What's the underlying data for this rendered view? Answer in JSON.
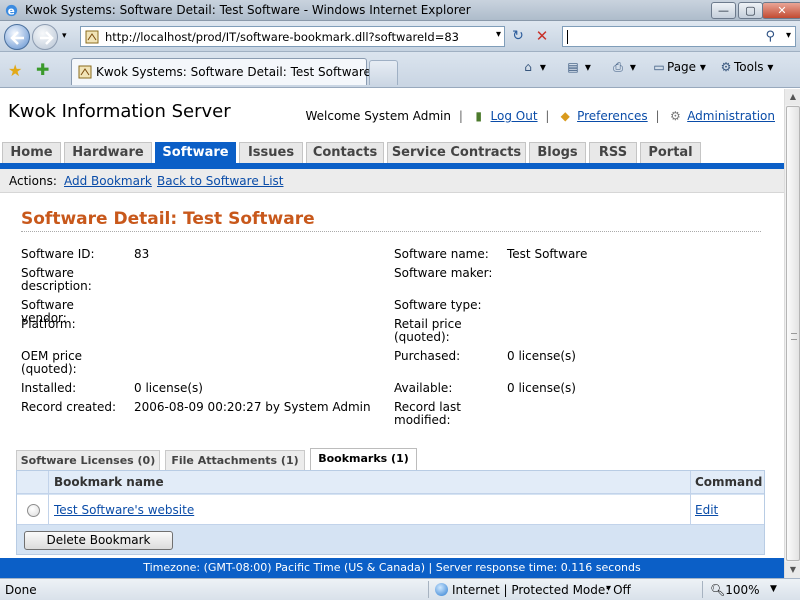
{
  "window": {
    "title": "Kwok Systems: Software Detail: Test Software - Windows Internet Explorer",
    "minimize": "—",
    "maximize": "▢",
    "close": "✕"
  },
  "addressbar": {
    "url": "http://localhost/prod/IT/software-bookmark.dll?softwareId=83",
    "refresh": "↻",
    "stop": "✕",
    "search_value": ""
  },
  "browser_tab": {
    "label": "Kwok Systems: Software Detail: Test Software"
  },
  "commandbar": {
    "home": "⌂",
    "feeds": "▤",
    "print": "⎙",
    "page_label": "Page",
    "tools_label": "Tools",
    "dropdown": "▾"
  },
  "site": {
    "title": "Kwok Information Server",
    "welcome": "Welcome System Admin",
    "logout": "Log Out",
    "preferences": "Preferences",
    "administration": "Administration",
    "separator": "|"
  },
  "nav": {
    "tabs": [
      "Home",
      "Hardware",
      "Software",
      "Issues",
      "Contacts",
      "Service Contracts",
      "Blogs",
      "RSS",
      "Portal"
    ],
    "active": "Software"
  },
  "actions": {
    "label": "Actions:",
    "add_bookmark": "Add Bookmark",
    "back": "Back to Software List"
  },
  "detail": {
    "heading": "Software Detail: Test Software",
    "left": [
      {
        "label": "Software ID:",
        "value": "83"
      },
      {
        "label": "Software description:",
        "value": ""
      },
      {
        "label": "Software vendor:",
        "value": ""
      },
      {
        "label": "Platform:",
        "value": ""
      },
      {
        "label": "OEM price (quoted):",
        "value": ""
      },
      {
        "label": "Installed:",
        "value": "0 license(s)"
      },
      {
        "label": "Record created:",
        "value": "2006-08-09 00:20:27 by System Admin"
      }
    ],
    "right": [
      {
        "label": "Software name:",
        "value": "Test Software"
      },
      {
        "label": "Software maker:",
        "value": ""
      },
      {
        "label": "Software type:",
        "value": ""
      },
      {
        "label": "Retail price (quoted):",
        "value": ""
      },
      {
        "label": "Purchased:",
        "value": "0 license(s)"
      },
      {
        "label": "Available:",
        "value": "0 license(s)"
      },
      {
        "label": "Record last modified:",
        "value": ""
      }
    ]
  },
  "subtabs": {
    "items": [
      "Software Licenses (0)",
      "File Attachments (1)",
      "Bookmarks (1)"
    ],
    "active": "Bookmarks (1)"
  },
  "bookmarks": {
    "columns": [
      "Bookmark name",
      "Command"
    ],
    "rows": [
      {
        "name": "Test Software's website",
        "command": "Edit"
      }
    ],
    "delete_button": "Delete Bookmark"
  },
  "footer": {
    "text": "Timezone: (GMT-08:00) Pacific Time (US & Canada) | Server response time: 0.116 seconds"
  },
  "status": {
    "text": "Done",
    "zone": "Internet | Protected Mode: Off",
    "zoom": "100%"
  },
  "colors": {
    "accent_blue": "#0b5fc7",
    "heading_orange": "#c8581b",
    "link_blue": "#0a4ca8"
  }
}
